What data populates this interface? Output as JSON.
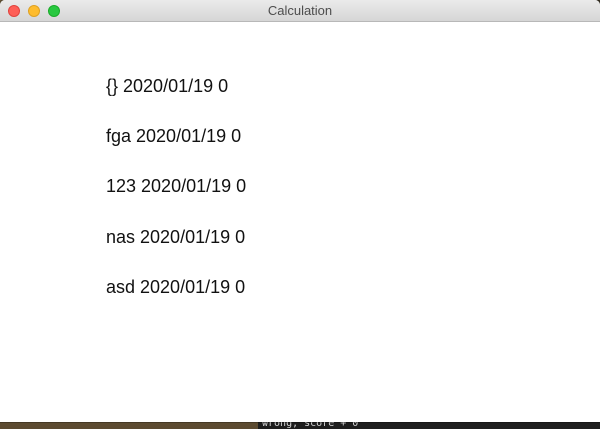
{
  "window": {
    "title": "Calculation"
  },
  "rows": [
    {
      "text": "{} 2020/01/19 0"
    },
    {
      "text": "fga 2020/01/19 0"
    },
    {
      "text": "123 2020/01/19 0"
    },
    {
      "text": "nas 2020/01/19 0"
    },
    {
      "text": "asd 2020/01/19 0"
    }
  ],
  "background": {
    "terminal_text": "wrong, score + 0"
  },
  "colors": {
    "close": "#fe5f57",
    "minimize": "#febc2e",
    "maximize": "#28c840"
  }
}
